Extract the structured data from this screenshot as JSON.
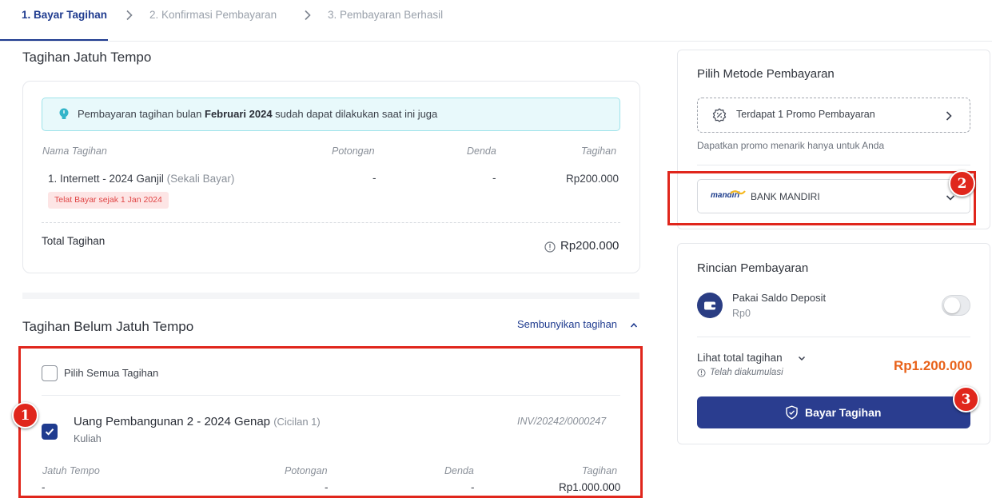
{
  "stepper": {
    "steps": [
      "1. Bayar Tagihan",
      "2. Konfirmasi Pembayaran",
      "3. Pembayaran Berhasil"
    ]
  },
  "due": {
    "title": "Tagihan Jatuh Tempo",
    "info_prefix": "Pembayaran tagihan bulan ",
    "info_bold": "Februari 2024",
    "info_suffix": " sudah dapat dilakukan saat ini juga",
    "headers": {
      "name": "Nama Tagihan",
      "discount": "Potongan",
      "fine": "Denda",
      "amount": "Tagihan"
    },
    "row": {
      "name": "1. Internett - 2024 Ganjil",
      "type": "(Sekali Bayar)",
      "discount": "-",
      "fine": "-",
      "amount": "Rp200.000",
      "badge": "Telat Bayar sejak 1 Jan 2024"
    },
    "total_label": "Total Tagihan",
    "total_value": "Rp200.000"
  },
  "notdue": {
    "title": "Tagihan Belum Jatuh Tempo",
    "hide_link": "Sembunyikan tagihan",
    "select_all": "Pilih Semua Tagihan",
    "item": {
      "name": "Uang Pembangunan 2 - 2024 Genap",
      "type": "(Cicilan 1)",
      "category": "Kuliah",
      "invoice": "INV/20242/0000247",
      "checked": true
    },
    "headers": {
      "due": "Jatuh Tempo",
      "discount": "Potongan",
      "fine": "Denda",
      "amount": "Tagihan"
    },
    "values": {
      "due": "-",
      "discount": "-",
      "fine": "-",
      "amount": "Rp1.000.000"
    }
  },
  "payment_method": {
    "title": "Pilih Metode Pembayaran",
    "promo_label": "Terdapat 1 Promo Pembayaran",
    "promo_caption": "Dapatkan promo menarik hanya untuk Anda",
    "bank_logo_text": "mandiri",
    "bank_name": "BANK MANDIRI"
  },
  "details": {
    "title": "Rincian Pembayaran",
    "deposit_label": "Pakai Saldo Deposit",
    "deposit_value": "Rp0",
    "total_link": "Lihat total tagihan",
    "accumulated": "Telah diakumulasi",
    "grand_total": "Rp1.200.000",
    "pay_button": "Bayar Tagihan"
  },
  "markers": [
    "1",
    "2",
    "3"
  ],
  "colors": {
    "primary": "#2a3d8f",
    "annotation_red": "#e0261c",
    "total_orange": "#e8621a"
  }
}
